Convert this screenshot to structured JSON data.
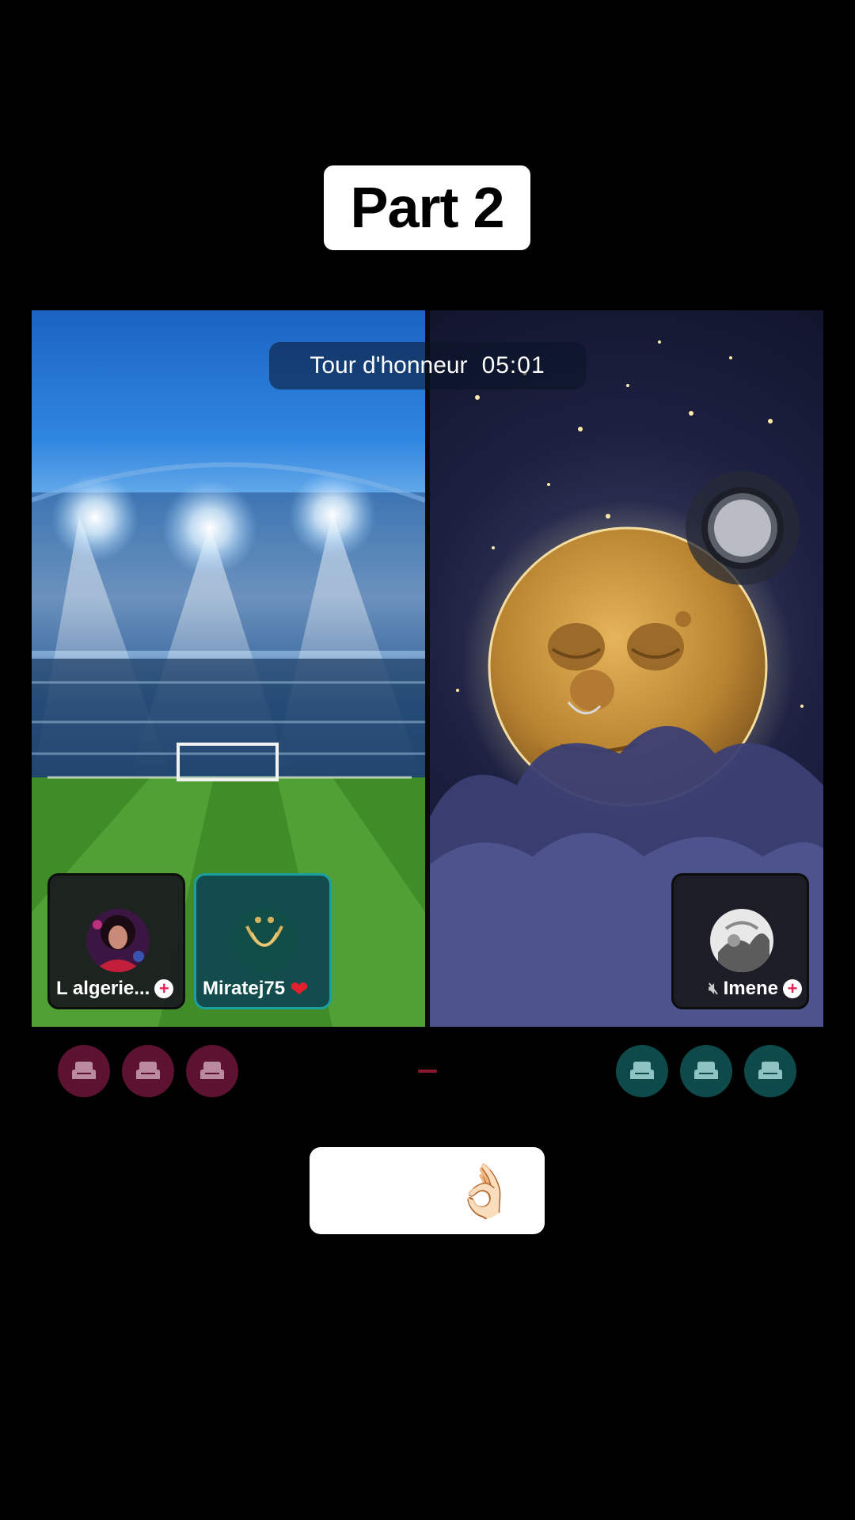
{
  "caption": {
    "title": "Part 2"
  },
  "battle": {
    "timer_label": "Tour d'honneur",
    "timer_value": "05:01",
    "left_users": [
      {
        "name": "L algerie...",
        "action_icon": "plus-icon"
      },
      {
        "name": "Miratej75",
        "badge_icon": "heart-icon"
      }
    ],
    "right_users": [
      {
        "name": "Imene",
        "status_icon": "muted-speaker-icon",
        "action_icon": "plus-icon"
      }
    ],
    "seats_left_count": 3,
    "seats_right_count": 3
  },
  "emoji_caption": {
    "emojis": [
      "😌",
      "😌",
      "👌🏻"
    ]
  },
  "colors": {
    "seat_pink": "#5c1230",
    "seat_teal": "#0f4a4a",
    "card_teal_border": "#1aa0a0",
    "plus_pink": "#e6245a"
  }
}
